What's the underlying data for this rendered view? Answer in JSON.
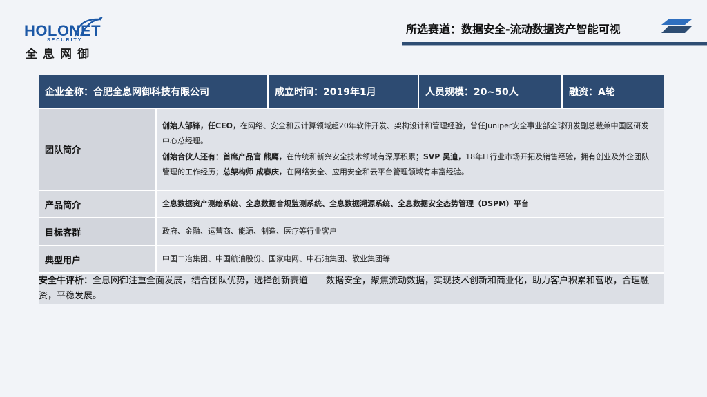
{
  "logo": {
    "en": "HOLONET",
    "sub": "SECURITY",
    "cn": "全息网御"
  },
  "header": {
    "track_title": "所选赛道：数据安全-流动数据资产智能可视"
  },
  "company": {
    "full_name": "企业全称：合肥全息网御科技有限公司",
    "founded": "成立时间：2019年1月",
    "size": "人员规模：20~50人",
    "funding": "融资：A轮"
  },
  "team": {
    "label": "团队简介",
    "founder_bold": "创始人邹锋，任CEO",
    "founder_rest": "，在网络、安全和云计算领域超20年软件开发、架构设计和管理经验，曾任Juniper安全事业部全球研发副总裁兼中国区研发中心总经理。",
    "partners_bold": "创始合伙人还有：首席产品官 熊鹰",
    "partners_a": "，在传统和新兴安全技术领域有深厚积累；",
    "partners_b_bold": "SVP 吴迪",
    "partners_b": "，18年IT行业市场开拓及销售经验，拥有创业及外企团队管理的工作经历；",
    "partners_c_bold": "总架构师 成春庆",
    "partners_c": "，在网络安全、应用安全和云平台管理领域有丰富经验。"
  },
  "product": {
    "label": "产品简介",
    "text": "全息数据资产测绘系统、全息数据合规监测系统、全息数据溯源系统、全息数据安全态势管理（DSPM）平台"
  },
  "customers": {
    "label": "目标客群",
    "text": "政府、金融、运营商、能源、制造、医疗等行业客户"
  },
  "users": {
    "label": "典型用户",
    "text": "中国二冶集团、中国航油股份、国家电网、中石油集团、敬业集团等"
  },
  "comment": {
    "label": "安全牛评析：",
    "text": "全息网御注重全面发展，结合团队优势，选择创新赛道——数据安全，聚焦流动数据，实现技术创新和商业化，助力客户积累和营收，合理融资，平稳发展。"
  },
  "colors": {
    "header_bg": "#2d4b72",
    "logo_blue": "#1c58a6",
    "row_bg": "#dfe2e8"
  }
}
